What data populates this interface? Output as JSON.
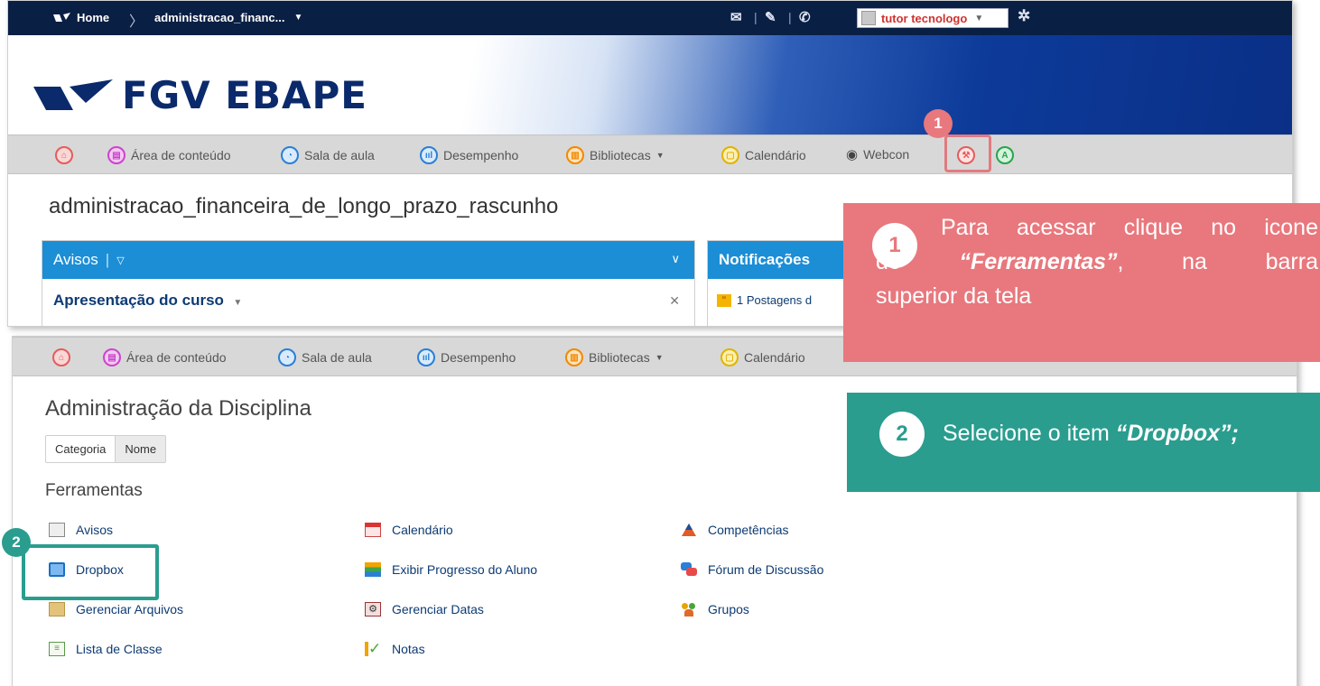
{
  "topbar": {
    "home_label": "Home",
    "course_short": "administracao_financ...",
    "user_name": "tutor tecnologo"
  },
  "brand": {
    "logo_text": "FGV EBAPE"
  },
  "navbar": {
    "conteudo": "Área de conteúdo",
    "sala": "Sala de aula",
    "desempenho": "Desempenho",
    "bibliotecas": "Bibliotecas",
    "calendario": "Calendário",
    "webcon": "Webcon"
  },
  "course": {
    "title": "administracao_financeira_de_longo_prazo_rascunho"
  },
  "avisos_widget": {
    "title": "Avisos",
    "item": "Apresentação do curso"
  },
  "notificacoes_widget": {
    "title": "Notificações",
    "item": "1 Postagens d"
  },
  "admin": {
    "title": "Administração da Disciplina",
    "seg_categoria": "Categoria",
    "seg_nome": "Nome",
    "section": "Ferramentas",
    "tools": {
      "avisos": "Avisos",
      "dropbox": "Dropbox",
      "gerenciar_arquivos": "Gerenciar Arquivos",
      "lista_classe": "Lista de Classe",
      "calendario": "Calendário",
      "exibir_progresso": "Exibir Progresso do Aluno",
      "gerenciar_datas": "Gerenciar Datas",
      "notas": "Notas",
      "competencias": "Competências",
      "forum": "Fórum de Discussão",
      "grupos": "Grupos"
    }
  },
  "steps": {
    "step1_number": "1",
    "step1_line1": "Para acessar clique no icone",
    "step1_line2a": "de",
    "step1_line2b": "“Ferramentas”",
    "step1_line2c": ",",
    "step1_line2d": "na",
    "step1_line2e": "barra",
    "step1_line3": "superior da tela",
    "step2_number": "2",
    "step2_text": "Selecione o item ",
    "step2_item": "“Dropbox”;"
  },
  "colors": {
    "callout1": "#e8787d",
    "callout2": "#2a9d8f",
    "brand_blue": "#0a2a6c",
    "widget_header": "#1b8ed6"
  }
}
